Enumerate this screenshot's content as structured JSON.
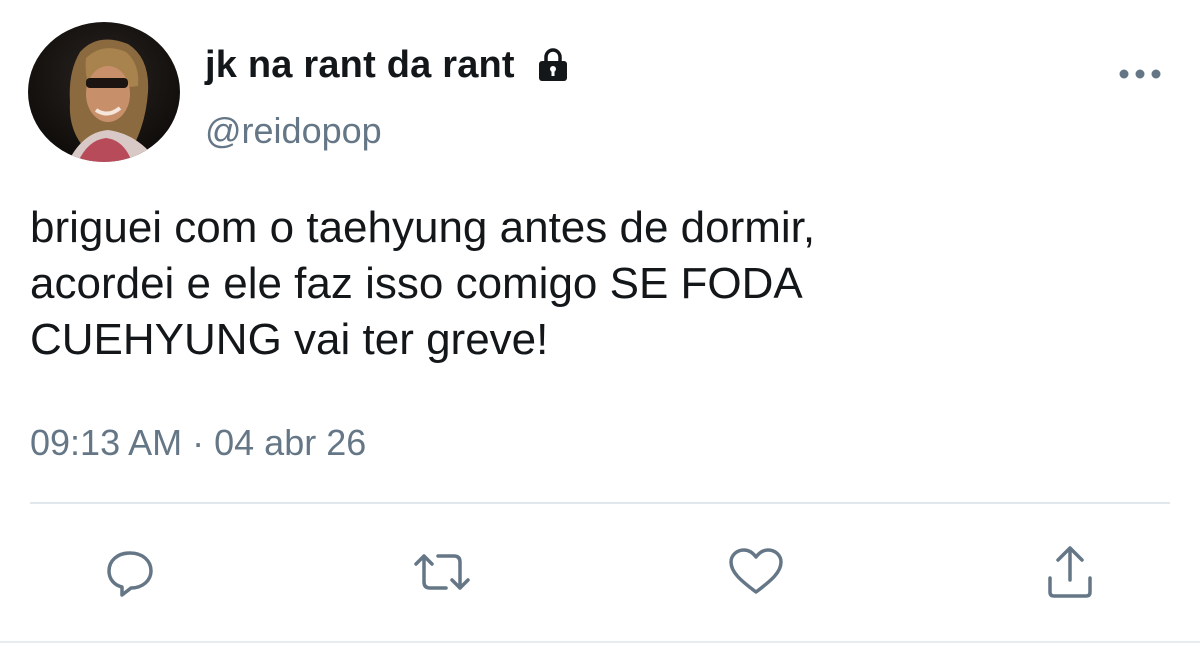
{
  "user": {
    "display_name": "jk na rant da rant",
    "handle": "@reidopop",
    "avatar": "avatar-photo",
    "protected_icon": "lock-icon"
  },
  "tweet": {
    "text": "briguei com o taehyung antes de dormir,\nacordei e ele faz isso comigo SE FODA\nCUEHYUNG vai ter greve!",
    "time": "09:13 AM",
    "separator": "·",
    "date": "04 abr 26"
  },
  "actions": {
    "more": "more-dots-icon",
    "reply": "reply-icon",
    "retweet": "retweet-icon",
    "like": "heart-icon",
    "share": "share-icon"
  },
  "colors": {
    "text_primary": "#14171a",
    "text_secondary": "#657786",
    "icon": "#657786",
    "divider": "#e1e8ed"
  }
}
